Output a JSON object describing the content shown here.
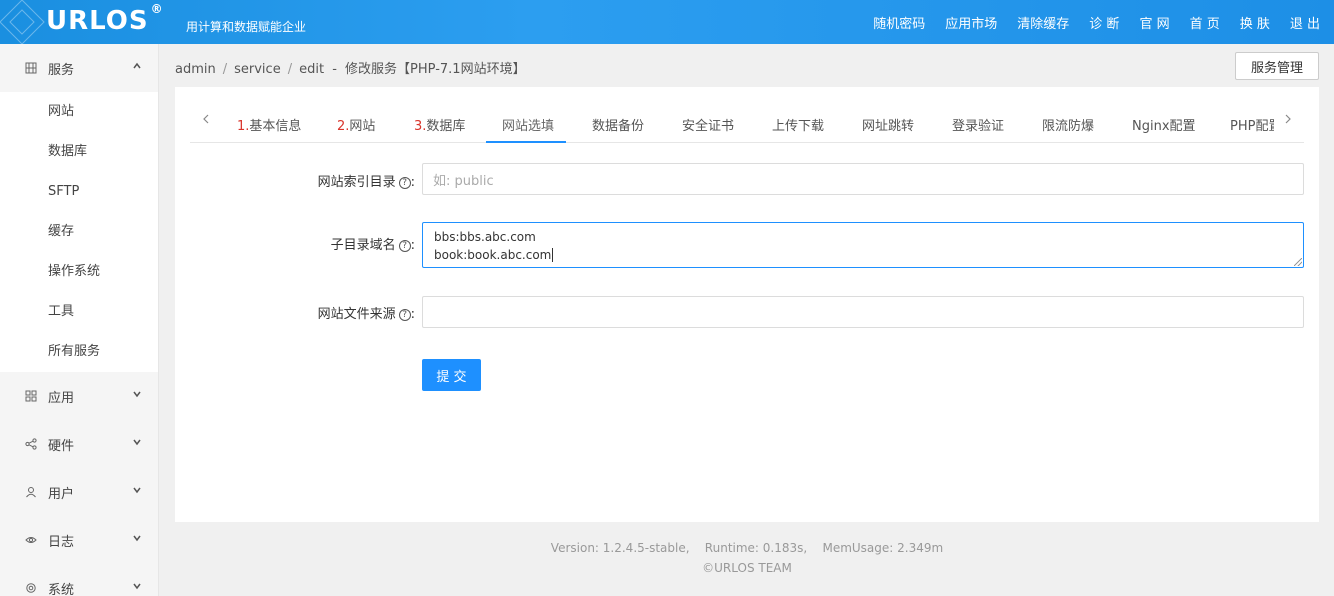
{
  "header": {
    "logo": "URLOS",
    "logo_mark": "®",
    "slogan": "用计算和数据赋能企业",
    "nav": [
      "随机密码",
      "应用市场",
      "清除缓存",
      "诊 断",
      "官 网",
      "首 页",
      "换 肤",
      "退 出"
    ]
  },
  "sidebar": {
    "groups": [
      {
        "label": "服务",
        "icon": "grid-icon",
        "expanded": true,
        "items": [
          "网站",
          "数据库",
          "SFTP",
          "缓存",
          "操作系统",
          "工具",
          "所有服务"
        ]
      },
      {
        "label": "应用",
        "icon": "apps-icon"
      },
      {
        "label": "硬件",
        "icon": "share-icon"
      },
      {
        "label": "用户",
        "icon": "user-icon"
      },
      {
        "label": "日志",
        "icon": "eye-icon"
      },
      {
        "label": "系统",
        "icon": "settings-icon"
      }
    ]
  },
  "breadcrumb": {
    "items": [
      "admin",
      "service",
      "edit"
    ],
    "dash": "-",
    "current": "修改服务【PHP-7.1网站环境】"
  },
  "manage_button": "服务管理",
  "tabs": [
    {
      "num": "1.",
      "label": "基本信息"
    },
    {
      "num": "2.",
      "label": "网站"
    },
    {
      "num": "3.",
      "label": "数据库"
    },
    {
      "num": "",
      "label": "网站选填",
      "active": true
    },
    {
      "num": "",
      "label": "数据备份"
    },
    {
      "num": "",
      "label": "安全证书"
    },
    {
      "num": "",
      "label": "上传下载"
    },
    {
      "num": "",
      "label": "网址跳转"
    },
    {
      "num": "",
      "label": "登录验证"
    },
    {
      "num": "",
      "label": "限流防爆"
    },
    {
      "num": "",
      "label": "Nginx配置"
    },
    {
      "num": "",
      "label": "PHP配置"
    }
  ],
  "form": {
    "index_dir": {
      "label": "网站索引目录",
      "placeholder": "如: public",
      "value": ""
    },
    "subdomain": {
      "label": "子目录域名",
      "lines": [
        "bbs:bbs.abc.com",
        "book:book.abc.com"
      ]
    },
    "source": {
      "label": "网站文件来源",
      "value": ""
    },
    "colon": ":",
    "submit": "提 交"
  },
  "footer": {
    "version_line": "Version: 1.2.4.5-stable,    Runtime: 0.183s,    MemUsage: 2.349m",
    "copyright": "©URLOS TEAM"
  },
  "colors": {
    "primary": "#1e90ff",
    "tab_number": "#d9342b"
  }
}
